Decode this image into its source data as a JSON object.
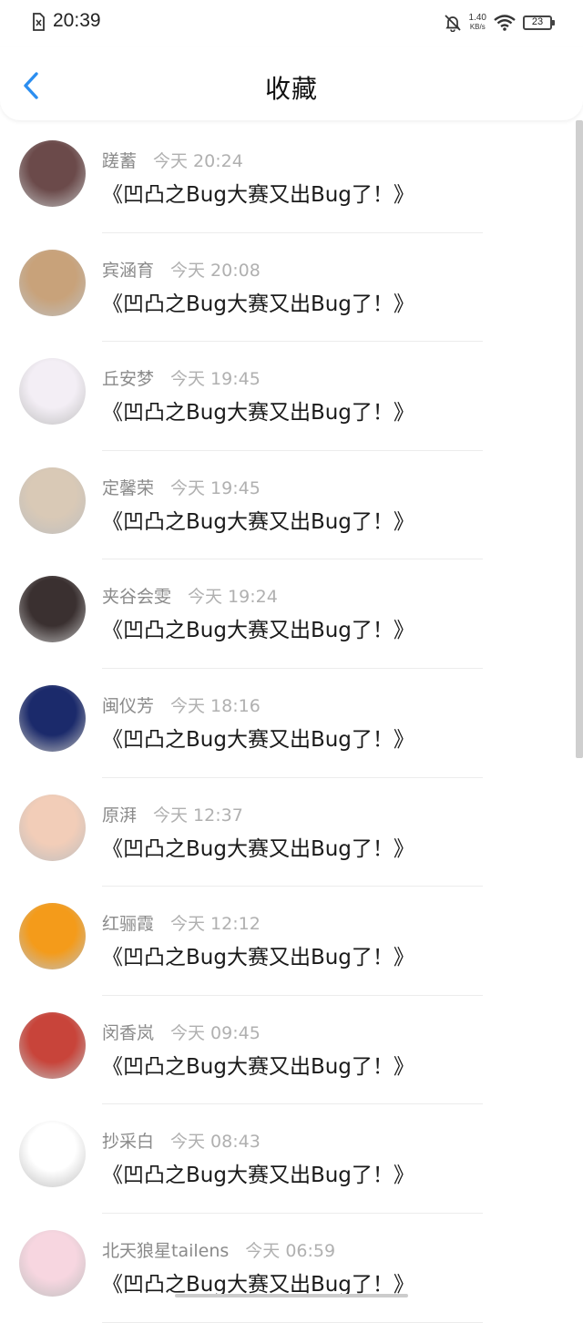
{
  "status_bar": {
    "time": "20:39",
    "net_speed_value": "1.40",
    "net_speed_unit": "KB/s",
    "battery": "23"
  },
  "header": {
    "title": "收藏"
  },
  "favorites": [
    {
      "user": "蹉蓄",
      "time": "今天 20:24",
      "content": "《凹凸之Bug大赛又出Bug了！》",
      "avatar_color": "#6b4a4a"
    },
    {
      "user": "宾涵育",
      "time": "今天 20:08",
      "content": "《凹凸之Bug大赛又出Bug了！》",
      "avatar_color": "#c8a27a"
    },
    {
      "user": "丘安梦",
      "time": "今天 19:45",
      "content": "《凹凸之Bug大赛又出Bug了！》",
      "avatar_color": "#f3eef5"
    },
    {
      "user": "定馨荣",
      "time": "今天 19:45",
      "content": "《凹凸之Bug大赛又出Bug了！》",
      "avatar_color": "#d9c9b6"
    },
    {
      "user": "夹谷会雯",
      "time": "今天 19:24",
      "content": "《凹凸之Bug大赛又出Bug了！》",
      "avatar_color": "#3a3030"
    },
    {
      "user": "闽仪芳",
      "time": "今天 18:16",
      "content": "《凹凸之Bug大赛又出Bug了！》",
      "avatar_color": "#1b2a6b"
    },
    {
      "user": "原湃",
      "time": "今天 12:37",
      "content": "《凹凸之Bug大赛又出Bug了！》",
      "avatar_color": "#f2cdb8"
    },
    {
      "user": "红骊霞",
      "time": "今天 12:12",
      "content": "《凹凸之Bug大赛又出Bug了！》",
      "avatar_color": "#f49b1a"
    },
    {
      "user": "闵香岚",
      "time": "今天 09:45",
      "content": "《凹凸之Bug大赛又出Bug了！》",
      "avatar_color": "#c8443a"
    },
    {
      "user": "抄采白",
      "time": "今天 08:43",
      "content": "《凹凸之Bug大赛又出Bug了！》",
      "avatar_color": "#ffffff"
    },
    {
      "user": "北天狼星tailens",
      "time": "今天 06:59",
      "content": "《凹凸之Bug大赛又出Bug了！》",
      "avatar_color": "#f7d6e0"
    }
  ]
}
